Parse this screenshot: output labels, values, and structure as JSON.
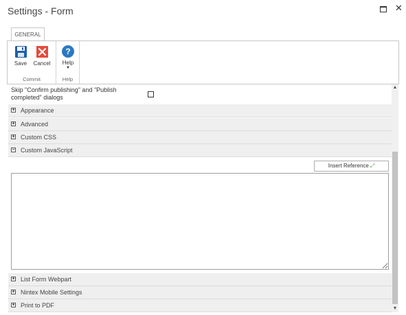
{
  "window": {
    "title": "Settings - Form",
    "maximize_icon": "maximize-icon",
    "close_glyph": "✕"
  },
  "ribbon": {
    "tab_label": "GENERAL",
    "groups": [
      {
        "label": "Commit",
        "buttons": [
          {
            "label": "Save",
            "icon": "save-icon",
            "color": "#1f5fa8"
          },
          {
            "label": "Cancel",
            "icon": "cancel-icon",
            "color": "#e44b3c"
          }
        ]
      },
      {
        "label": "Help",
        "buttons": [
          {
            "label": "Help",
            "icon": "help-icon",
            "color": "#2b78c2",
            "glyph": "?"
          }
        ]
      }
    ]
  },
  "settings": {
    "skip_dialogs_label": "Skip \"Confirm publishing\" and \"Publish completed\" dialogs",
    "skip_dialogs_checked": false,
    "sections": [
      {
        "label": "Appearance",
        "toggle": "+"
      },
      {
        "label": "Advanced",
        "toggle": "+"
      },
      {
        "label": "Custom CSS",
        "toggle": "+"
      },
      {
        "label": "Custom JavaScript",
        "toggle": "−"
      },
      {
        "label": "List Form Webpart",
        "toggle": "+"
      },
      {
        "label": "Nintex Mobile Settings",
        "toggle": "+"
      },
      {
        "label": "Print to PDF",
        "toggle": "+"
      }
    ],
    "insert_reference_label": "Insert Reference",
    "custom_js_value": ""
  },
  "scrollbar": {
    "up_glyph": "▲",
    "down_glyph": "▼"
  }
}
